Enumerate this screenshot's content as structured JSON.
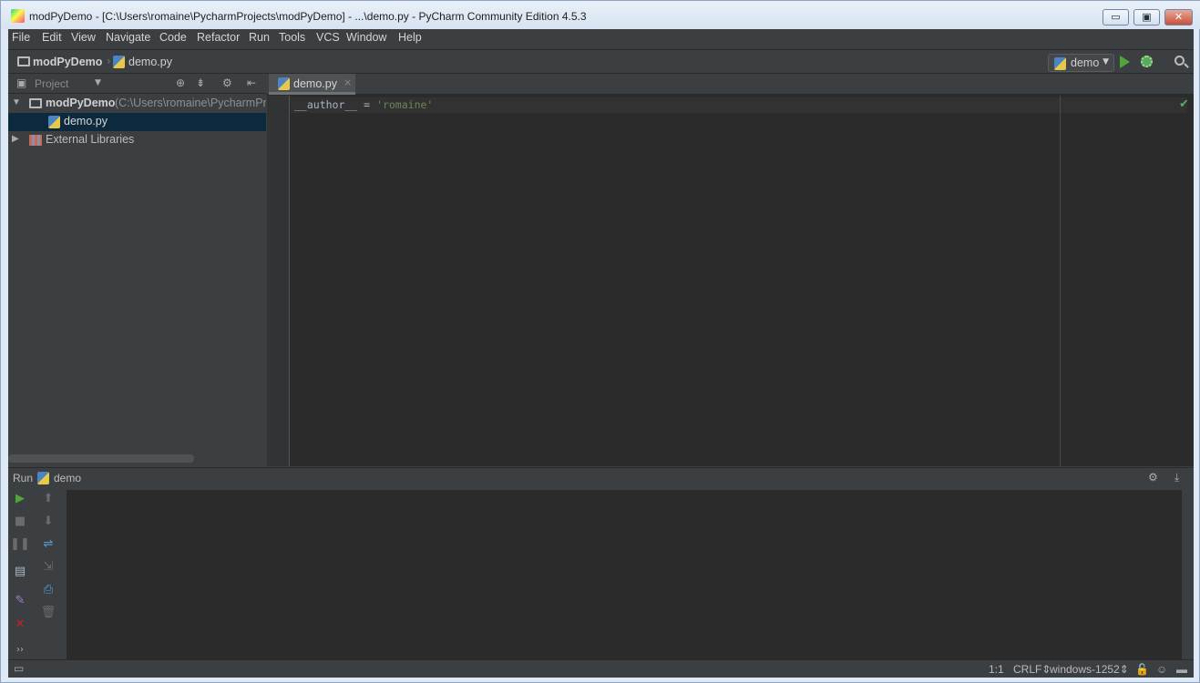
{
  "window": {
    "title": "modPyDemo - [C:\\Users\\romaine\\PycharmProjects\\modPyDemo] - ...\\demo.py - PyCharm Community Edition 4.5.3",
    "minimize_label": "▭",
    "maximize_label": "▣",
    "close_label": "✕"
  },
  "menu": [
    "File",
    "Edit",
    "View",
    "Navigate",
    "Code",
    "Refactor",
    "Run",
    "Tools",
    "VCS",
    "Window",
    "Help"
  ],
  "navbar": {
    "project": "modPyDemo",
    "separator": "›",
    "file": "demo.py",
    "run_config": "demo"
  },
  "project_panel": {
    "header_label": "Project",
    "tree": [
      {
        "label": "modPyDemo",
        "path": "(C:\\Users\\romaine\\PycharmPro"
      },
      {
        "label": "demo.py"
      },
      {
        "label": "External Libraries"
      }
    ]
  },
  "editor": {
    "tab_label": "demo.py",
    "tab_close": "×",
    "code_name": "__author__",
    "code_op": " = ",
    "code_value": "'romaine'"
  },
  "run_panel": {
    "label": "Run",
    "config": "demo"
  },
  "statusbar": {
    "position": "1:1",
    "line_sep": "CRLF⇕",
    "encoding": "windows-1252⇕"
  },
  "colors": {
    "accent_run": "#4fa73a",
    "string": "#6a8759",
    "selection": "#0d293e",
    "close_red": "#c7222a"
  }
}
